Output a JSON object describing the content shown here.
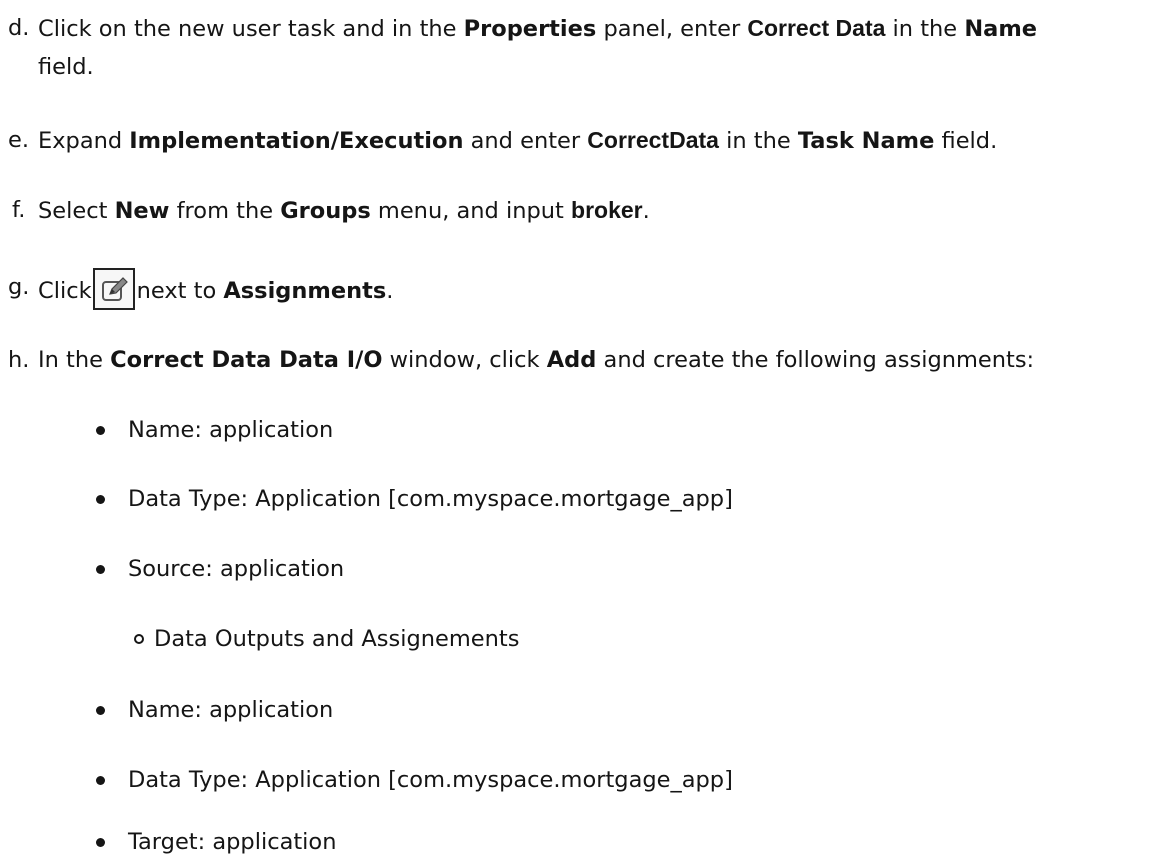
{
  "steps": {
    "d": {
      "marker": "d.",
      "t1": "Click on the new user task and in the ",
      "b1": "Properties",
      "t2": " panel, enter ",
      "b2": "Correct Data",
      "t3": " in the ",
      "b3": "Name",
      "t4": "field."
    },
    "e": {
      "marker": "e.",
      "t1": "Expand ",
      "b1": "Implementation/Execution",
      "t2": " and enter ",
      "b2": "CorrectData",
      "t3": " in the ",
      "b3": "Task Name",
      "t4": " field."
    },
    "f": {
      "marker": "f.",
      "t1": "Select ",
      "b1": "New",
      "t2": " from the ",
      "b2": "Groups",
      "t3": " menu, and input ",
      "b3": "broker",
      "t4": "."
    },
    "g": {
      "marker": "g.",
      "t1": "Click",
      "icon": "edit-icon",
      "t2": "next to ",
      "b1": "Assignments",
      "t3": "."
    },
    "h": {
      "marker": "h.",
      "t1": "In the ",
      "b1": "Correct Data Data I/O",
      "t2": " window, click ",
      "b2": "Add",
      "t3": " and create the following assignments:"
    }
  },
  "bullets": [
    "Name: application",
    "Data Type: Application [com.myspace.mortgage_app]",
    "Source: application"
  ],
  "sub_bullet": "Data Outputs and Assignements",
  "bullets2": [
    "Name: application",
    "Data Type: Application [com.myspace.mortgage_app]",
    "Target: application"
  ]
}
